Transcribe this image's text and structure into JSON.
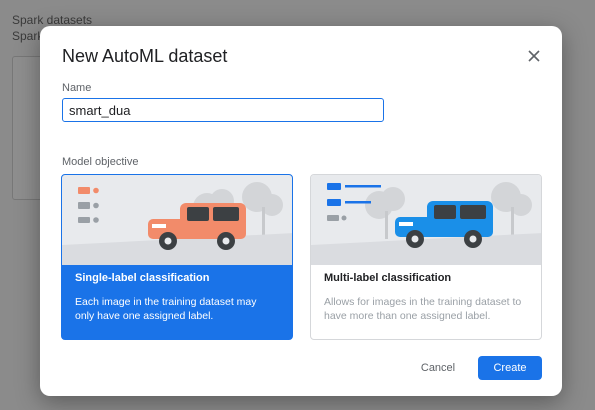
{
  "background": {
    "line1": "Spark datasets",
    "line2": "Spark"
  },
  "dialog": {
    "title": "New AutoML dataset",
    "close_icon": "close-icon",
    "name_label": "Name",
    "name_value": "smart_dua",
    "objective_label": "Model objective",
    "options": [
      {
        "title": "Single-label classification",
        "description": "Each image in the training dataset may only have one assigned label.",
        "selected": true,
        "car_color": "#f28b6a"
      },
      {
        "title": "Multi-label classification",
        "description": "Allows for images in the training dataset to have more than one assigned label.",
        "selected": false,
        "car_color": "#1a8fe8"
      }
    ],
    "cancel_label": "Cancel",
    "create_label": "Create"
  },
  "colors": {
    "accent": "#1a73e8",
    "overlay": "#8b8b8b"
  }
}
